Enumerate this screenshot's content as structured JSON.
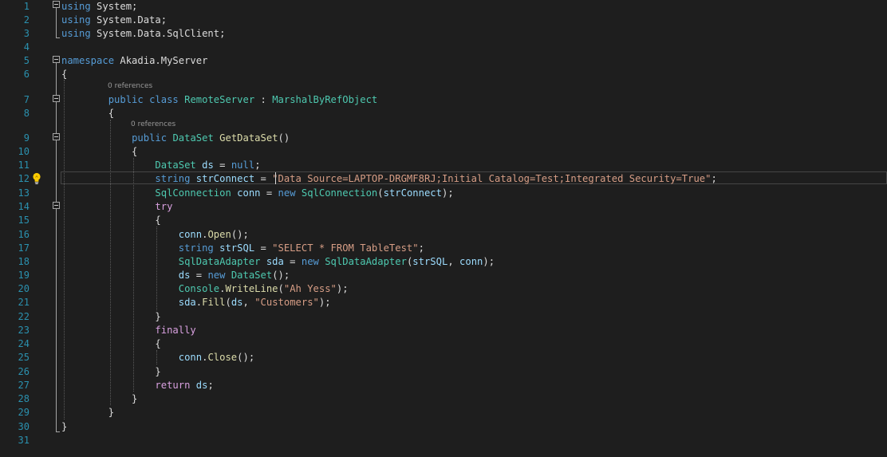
{
  "editor": {
    "codelens": {
      "references": "0 references"
    },
    "lines": [
      {
        "num": "1",
        "segments": [
          {
            "text": "using",
            "cls": "kw"
          },
          {
            "text": " System;",
            "cls": "pl"
          }
        ]
      },
      {
        "num": "2",
        "segments": [
          {
            "text": "using",
            "cls": "kw"
          },
          {
            "text": " System.Data;",
            "cls": "pl"
          }
        ]
      },
      {
        "num": "3",
        "segments": [
          {
            "text": "using",
            "cls": "kw"
          },
          {
            "text": " System.Data.SqlClient;",
            "cls": "pl"
          }
        ]
      },
      {
        "num": "4",
        "segments": []
      },
      {
        "num": "5",
        "segments": [
          {
            "text": "namespace",
            "cls": "kw"
          },
          {
            "text": " Akadia.MyServer",
            "cls": "pl"
          }
        ]
      },
      {
        "num": "6",
        "segments": [
          {
            "text": "{",
            "cls": "pl"
          }
        ]
      },
      {
        "num": "7",
        "segments": [
          {
            "text": "        ",
            "cls": "pl"
          },
          {
            "text": "public",
            "cls": "kw"
          },
          {
            "text": " ",
            "cls": "pl"
          },
          {
            "text": "class",
            "cls": "kw"
          },
          {
            "text": " ",
            "cls": "pl"
          },
          {
            "text": "RemoteServer",
            "cls": "type"
          },
          {
            "text": " : ",
            "cls": "pl"
          },
          {
            "text": "MarshalByRefObject",
            "cls": "type"
          }
        ]
      },
      {
        "num": "8",
        "segments": [
          {
            "text": "        {",
            "cls": "pl"
          }
        ]
      },
      {
        "num": "9",
        "segments": [
          {
            "text": "            ",
            "cls": "pl"
          },
          {
            "text": "public",
            "cls": "kw"
          },
          {
            "text": " ",
            "cls": "pl"
          },
          {
            "text": "DataSet",
            "cls": "type"
          },
          {
            "text": " ",
            "cls": "pl"
          },
          {
            "text": "GetDataSet",
            "cls": "fn"
          },
          {
            "text": "()",
            "cls": "pl"
          }
        ]
      },
      {
        "num": "10",
        "segments": [
          {
            "text": "            {",
            "cls": "pl"
          }
        ]
      },
      {
        "num": "11",
        "segments": [
          {
            "text": "                ",
            "cls": "pl"
          },
          {
            "text": "DataSet",
            "cls": "type"
          },
          {
            "text": " ",
            "cls": "pl"
          },
          {
            "text": "ds",
            "cls": "var"
          },
          {
            "text": " = ",
            "cls": "pl"
          },
          {
            "text": "null",
            "cls": "kw"
          },
          {
            "text": ";",
            "cls": "pl"
          }
        ]
      },
      {
        "num": "12",
        "segments": [
          {
            "text": "                ",
            "cls": "pl"
          },
          {
            "text": "string",
            "cls": "kw"
          },
          {
            "text": " ",
            "cls": "pl"
          },
          {
            "text": "strConnect",
            "cls": "var"
          },
          {
            "text": " = ",
            "cls": "pl"
          },
          {
            "text": "\"Data Source=LAPTOP-DRGMF8RJ;Initial Catalog=Test;Integrated Security=True\"",
            "cls": "str"
          },
          {
            "text": ";",
            "cls": "pl"
          }
        ]
      },
      {
        "num": "13",
        "segments": [
          {
            "text": "                ",
            "cls": "pl"
          },
          {
            "text": "SqlConnection",
            "cls": "type"
          },
          {
            "text": " ",
            "cls": "pl"
          },
          {
            "text": "conn",
            "cls": "var"
          },
          {
            "text": " = ",
            "cls": "pl"
          },
          {
            "text": "new",
            "cls": "kw"
          },
          {
            "text": " ",
            "cls": "pl"
          },
          {
            "text": "SqlConnection",
            "cls": "type"
          },
          {
            "text": "(",
            "cls": "pl"
          },
          {
            "text": "strConnect",
            "cls": "var"
          },
          {
            "text": ");",
            "cls": "pl"
          }
        ]
      },
      {
        "num": "14",
        "segments": [
          {
            "text": "                ",
            "cls": "pl"
          },
          {
            "text": "try",
            "cls": "ctrl"
          }
        ]
      },
      {
        "num": "15",
        "segments": [
          {
            "text": "                {",
            "cls": "pl"
          }
        ]
      },
      {
        "num": "16",
        "segments": [
          {
            "text": "                    ",
            "cls": "pl"
          },
          {
            "text": "conn",
            "cls": "var"
          },
          {
            "text": ".",
            "cls": "pl"
          },
          {
            "text": "Open",
            "cls": "fn"
          },
          {
            "text": "();",
            "cls": "pl"
          }
        ]
      },
      {
        "num": "17",
        "segments": [
          {
            "text": "                    ",
            "cls": "pl"
          },
          {
            "text": "string",
            "cls": "kw"
          },
          {
            "text": " ",
            "cls": "pl"
          },
          {
            "text": "strSQL",
            "cls": "var"
          },
          {
            "text": " = ",
            "cls": "pl"
          },
          {
            "text": "\"SELECT * FROM TableTest\"",
            "cls": "str"
          },
          {
            "text": ";",
            "cls": "pl"
          }
        ]
      },
      {
        "num": "18",
        "segments": [
          {
            "text": "                    ",
            "cls": "pl"
          },
          {
            "text": "SqlDataAdapter",
            "cls": "type"
          },
          {
            "text": " ",
            "cls": "pl"
          },
          {
            "text": "sda",
            "cls": "var"
          },
          {
            "text": " = ",
            "cls": "pl"
          },
          {
            "text": "new",
            "cls": "kw"
          },
          {
            "text": " ",
            "cls": "pl"
          },
          {
            "text": "SqlDataAdapter",
            "cls": "type"
          },
          {
            "text": "(",
            "cls": "pl"
          },
          {
            "text": "strSQL",
            "cls": "var"
          },
          {
            "text": ", ",
            "cls": "pl"
          },
          {
            "text": "conn",
            "cls": "var"
          },
          {
            "text": ");",
            "cls": "pl"
          }
        ]
      },
      {
        "num": "19",
        "segments": [
          {
            "text": "                    ",
            "cls": "pl"
          },
          {
            "text": "ds",
            "cls": "var"
          },
          {
            "text": " = ",
            "cls": "pl"
          },
          {
            "text": "new",
            "cls": "kw"
          },
          {
            "text": " ",
            "cls": "pl"
          },
          {
            "text": "DataSet",
            "cls": "type"
          },
          {
            "text": "();",
            "cls": "pl"
          }
        ]
      },
      {
        "num": "20",
        "segments": [
          {
            "text": "                    ",
            "cls": "pl"
          },
          {
            "text": "Console",
            "cls": "type"
          },
          {
            "text": ".",
            "cls": "pl"
          },
          {
            "text": "WriteLine",
            "cls": "fn"
          },
          {
            "text": "(",
            "cls": "pl"
          },
          {
            "text": "\"Ah Yess\"",
            "cls": "str"
          },
          {
            "text": ");",
            "cls": "pl"
          }
        ]
      },
      {
        "num": "21",
        "segments": [
          {
            "text": "                    ",
            "cls": "pl"
          },
          {
            "text": "sda",
            "cls": "var"
          },
          {
            "text": ".",
            "cls": "pl"
          },
          {
            "text": "Fill",
            "cls": "fn"
          },
          {
            "text": "(",
            "cls": "pl"
          },
          {
            "text": "ds",
            "cls": "var"
          },
          {
            "text": ", ",
            "cls": "pl"
          },
          {
            "text": "\"Customers\"",
            "cls": "str"
          },
          {
            "text": ");",
            "cls": "pl"
          }
        ]
      },
      {
        "num": "22",
        "segments": [
          {
            "text": "                }",
            "cls": "pl"
          }
        ]
      },
      {
        "num": "23",
        "segments": [
          {
            "text": "                ",
            "cls": "pl"
          },
          {
            "text": "finally",
            "cls": "ctrl"
          }
        ]
      },
      {
        "num": "24",
        "segments": [
          {
            "text": "                {",
            "cls": "pl"
          }
        ]
      },
      {
        "num": "25",
        "segments": [
          {
            "text": "                    ",
            "cls": "pl"
          },
          {
            "text": "conn",
            "cls": "var"
          },
          {
            "text": ".",
            "cls": "pl"
          },
          {
            "text": "Close",
            "cls": "fn"
          },
          {
            "text": "();",
            "cls": "pl"
          }
        ]
      },
      {
        "num": "26",
        "segments": [
          {
            "text": "                }",
            "cls": "pl"
          }
        ]
      },
      {
        "num": "27",
        "segments": [
          {
            "text": "                ",
            "cls": "pl"
          },
          {
            "text": "return",
            "cls": "ctrl"
          },
          {
            "text": " ",
            "cls": "pl"
          },
          {
            "text": "ds",
            "cls": "var"
          },
          {
            "text": ";",
            "cls": "pl"
          }
        ]
      },
      {
        "num": "28",
        "segments": [
          {
            "text": "            }",
            "cls": "pl"
          }
        ]
      },
      {
        "num": "29",
        "segments": [
          {
            "text": "        }",
            "cls": "pl"
          }
        ]
      },
      {
        "num": "30",
        "segments": [
          {
            "text": "}",
            "cls": "pl"
          }
        ]
      },
      {
        "num": "31",
        "segments": []
      }
    ]
  },
  "colors": {
    "background": "#1e1e1e",
    "line_number": "#2b91af",
    "keyword": "#569cd6",
    "type": "#4ec9b0",
    "string": "#d69d85",
    "control": "#d8a0df",
    "method": "#dcdcaa",
    "variable": "#9cdcfe",
    "plain": "#dcdcdc"
  },
  "icons": {
    "quick_actions": "lightbulb-icon",
    "outline_toggle": "collapse-minus-icon"
  }
}
